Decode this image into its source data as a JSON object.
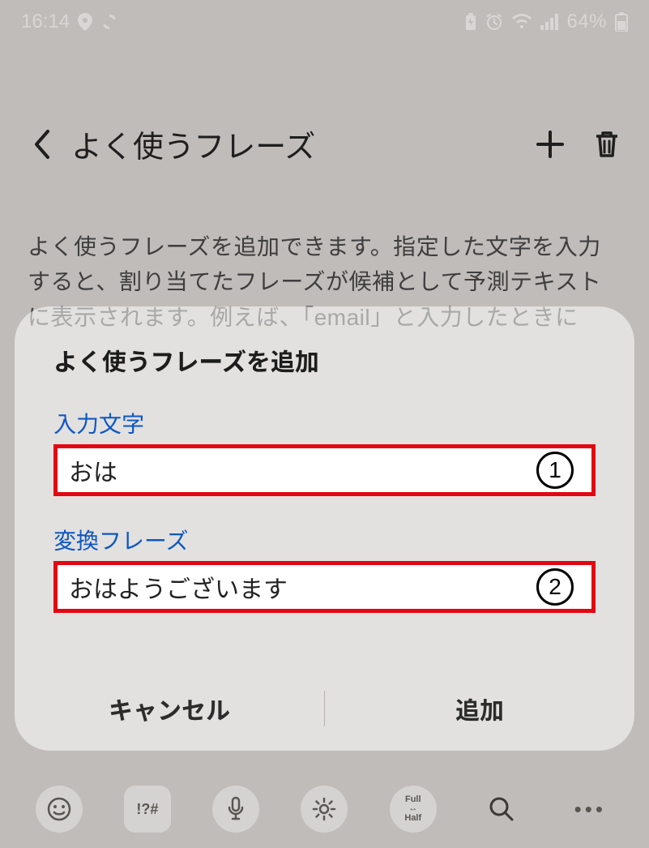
{
  "statusbar": {
    "time": "16:14",
    "battery_percent": "64%"
  },
  "page": {
    "title": "よく使うフレーズ",
    "description": "よく使うフレーズを追加できます。指定した文字を入力すると、割り当てたフレーズが候補として予測テキストに表示されます。例えば、「email」と入力したときに"
  },
  "modal": {
    "title": "よく使うフレーズを追加",
    "field1_label": "入力文字",
    "field1_value": "おは",
    "callout1": "1",
    "field2_label": "変換フレーズ",
    "field2_value": "おはようございます",
    "callout2": "2",
    "cancel_label": "キャンセル",
    "confirm_label": "追加"
  },
  "keyboard_toolbar": {
    "fullhalf_label": "Full Half"
  }
}
